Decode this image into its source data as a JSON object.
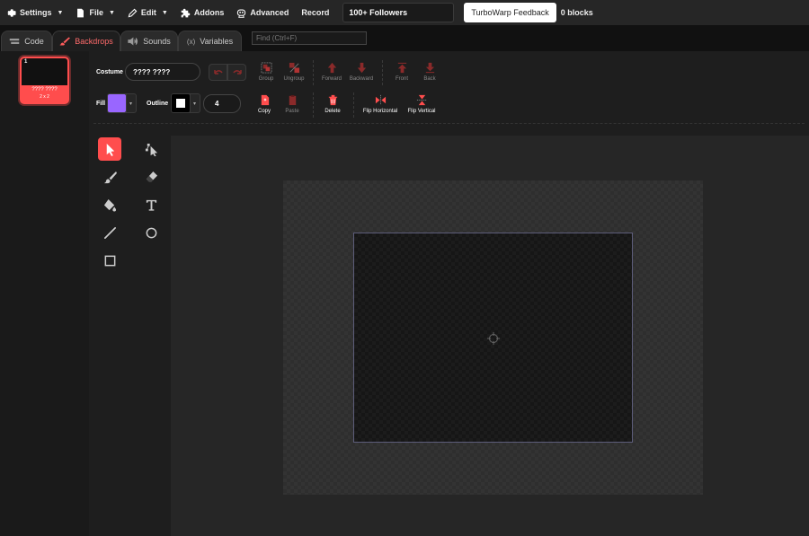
{
  "menubar": {
    "settings": "Settings",
    "file": "File",
    "edit": "Edit",
    "addons": "Addons",
    "advanced": "Advanced",
    "record": "Record",
    "project_title": "100+ Followers",
    "feedback": "TurboWarp Feedback",
    "block_count": "0 blocks"
  },
  "tabs": {
    "code": "Code",
    "backdrops": "Backdrops",
    "sounds": "Sounds",
    "variables": "Variables",
    "find_placeholder": "Find (Ctrl+F)"
  },
  "costume": {
    "number": "1",
    "name": "???? ????",
    "size": "2 x 2"
  },
  "editor": {
    "costume_label": "Costume",
    "costume_name": "???? ????",
    "fill_label": "Fill",
    "outline_label": "Outline",
    "fill_color": "#9966ff",
    "outline_color": "#ffffff",
    "outline_width": "4",
    "group": "Group",
    "ungroup": "Ungroup",
    "forward": "Forward",
    "backward": "Backward",
    "front": "Front",
    "back": "Back",
    "copy": "Copy",
    "paste": "Paste",
    "delete": "Delete",
    "flip_horizontal": "Flip Horizontal",
    "flip_vertical": "Flip Vertical"
  },
  "colors": {
    "accent": "#ff4d4d",
    "dark_accent": "#8a2a2a"
  },
  "tools": [
    "select-icon",
    "reshape-icon",
    "brush-icon",
    "eraser-icon",
    "fill-icon",
    "text-icon",
    "line-icon",
    "circle-icon",
    "rectangle-icon"
  ]
}
